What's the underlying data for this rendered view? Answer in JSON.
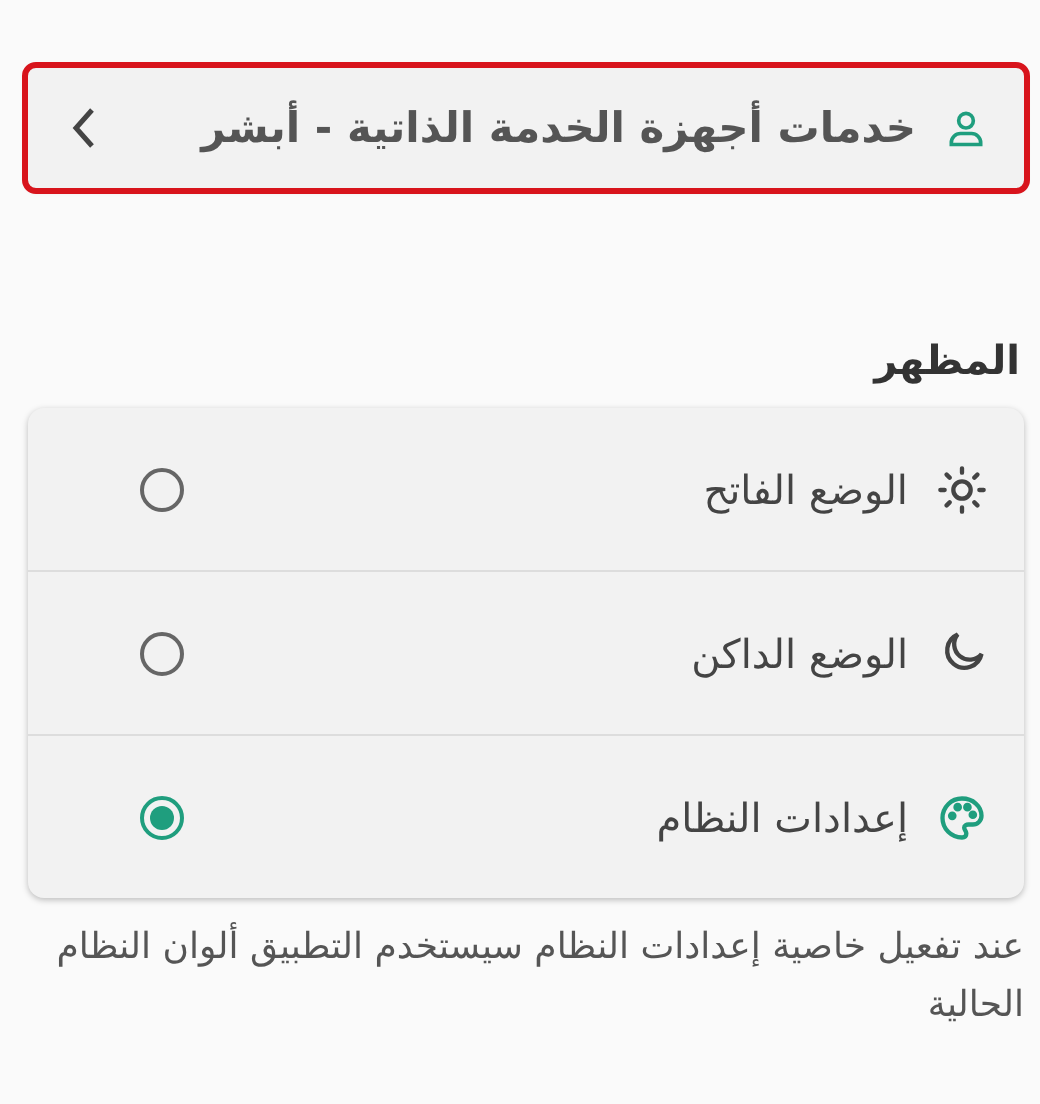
{
  "link_card": {
    "label": "خدمات أجهزة الخدمة الذاتية - أبشر",
    "highlighted": true
  },
  "appearance": {
    "heading": "المظهر",
    "options": [
      {
        "kind": "sun",
        "label": "الوضع الفاتح",
        "selected": false
      },
      {
        "kind": "moon",
        "label": "الوضع الداكن",
        "selected": false
      },
      {
        "kind": "palette",
        "label": "إعدادات النظام",
        "selected": true
      }
    ],
    "note": "عند تفعيل خاصية إعدادات النظام سيستخدم التطبيق ألوان النظام الحالية"
  }
}
